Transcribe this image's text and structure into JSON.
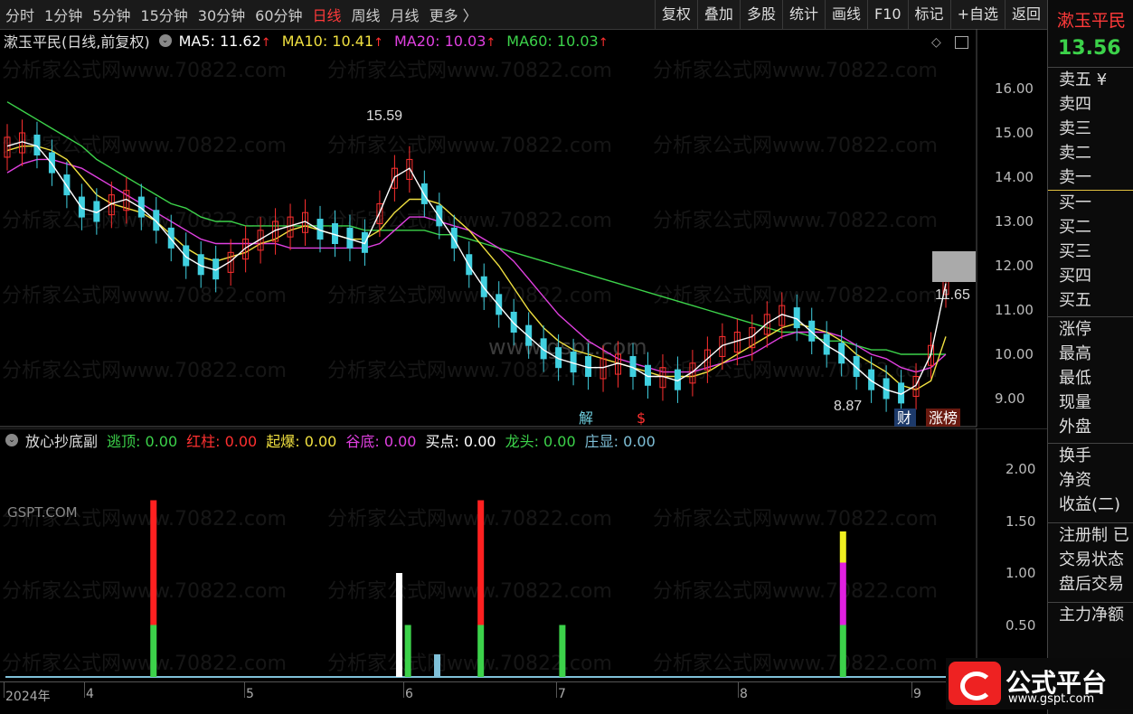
{
  "toolbar": {
    "periods": [
      "分时",
      "1分钟",
      "5分钟",
      "15分钟",
      "30分钟",
      "60分钟",
      "日线",
      "周线",
      "月线",
      "更多 〉"
    ],
    "active_period": "日线",
    "tools": [
      "复权",
      "叠加",
      "多股",
      "统计",
      "画线",
      "F10",
      "标记",
      "+自选",
      "返回"
    ]
  },
  "main_header": {
    "stock_label": "漱玉平民(日线,前复权)",
    "ma": [
      {
        "label": "MA5: 11.62",
        "color": "#ffffff"
      },
      {
        "label": "MA10: 10.41",
        "color": "#f0e040"
      },
      {
        "label": "MA20: 10.03",
        "color": "#e040e0"
      },
      {
        "label": "MA60: 10.03",
        "color": "#3cd24a"
      }
    ],
    "up_arrow": "↑"
  },
  "sub_header": {
    "name": "放心抄底副",
    "indicators": [
      {
        "label": "逃顶: 0.00",
        "color": "#3cd24a"
      },
      {
        "label": "红柱: 0.00",
        "color": "#ff3030"
      },
      {
        "label": "起爆: 0.00",
        "color": "#f0e040"
      },
      {
        "label": "谷底: 0.00",
        "color": "#e040e0"
      },
      {
        "label": "买点: 0.00",
        "color": "#ffffff"
      },
      {
        "label": "龙头: 0.00",
        "color": "#3cd24a"
      },
      {
        "label": "庄显: 0.00",
        "color": "#7fc0d8"
      }
    ]
  },
  "chart_data": [
    {
      "type": "candlestick",
      "y_ticks": [
        "16.00",
        "15.00",
        "14.00",
        "13.00",
        "12.00",
        "11.00",
        "10.00",
        "9.00"
      ],
      "ylim": [
        8.6,
        16.4
      ],
      "annotations": {
        "high": "15.59",
        "low": "8.87",
        "last": "11.65"
      },
      "markers": [
        "解",
        "$",
        "财",
        "涨榜"
      ],
      "ma5": [
        14.7,
        14.8,
        14.7,
        14.3,
        13.8,
        13.3,
        13.2,
        13.4,
        13.5,
        13.3,
        13.0,
        12.6,
        12.2,
        12.0,
        11.9,
        12.1,
        12.4,
        12.6,
        12.8,
        12.9,
        13.0,
        12.8,
        12.7,
        12.6,
        12.5,
        13.2,
        14.0,
        14.2,
        13.6,
        13.1,
        12.6,
        12.0,
        11.5,
        11.1,
        10.7,
        10.4,
        10.1,
        9.9,
        9.8,
        9.7,
        9.7,
        9.8,
        9.7,
        9.5,
        9.5,
        9.4,
        9.6,
        9.9,
        10.2,
        10.3,
        10.4,
        10.7,
        10.9,
        10.8,
        10.5,
        10.2,
        10.0,
        9.7,
        9.4,
        9.2,
        9.1,
        9.3,
        10.0,
        11.6
      ],
      "ma10": [
        14.6,
        14.7,
        14.7,
        14.6,
        14.4,
        14.0,
        13.6,
        13.4,
        13.3,
        13.2,
        13.0,
        12.7,
        12.4,
        12.2,
        12.1,
        12.2,
        12.3,
        12.5,
        12.6,
        12.8,
        12.9,
        12.8,
        12.7,
        12.6,
        12.6,
        12.8,
        13.2,
        13.5,
        13.5,
        13.4,
        13.1,
        12.8,
        12.4,
        12.0,
        11.5,
        11.0,
        10.6,
        10.3,
        10.1,
        10.0,
        9.9,
        9.8,
        9.7,
        9.6,
        9.5,
        9.5,
        9.5,
        9.6,
        9.8,
        10.0,
        10.2,
        10.4,
        10.6,
        10.7,
        10.6,
        10.5,
        10.3,
        10.0,
        9.8,
        9.6,
        9.3,
        9.2,
        9.4,
        10.4
      ],
      "ma20": [
        14.1,
        14.3,
        14.4,
        14.4,
        14.3,
        14.2,
        14.0,
        13.8,
        13.6,
        13.4,
        13.2,
        13.0,
        12.8,
        12.6,
        12.5,
        12.5,
        12.5,
        12.5,
        12.5,
        12.4,
        12.4,
        12.4,
        12.4,
        12.4,
        12.4,
        12.5,
        12.8,
        13.1,
        13.1,
        13.0,
        12.9,
        12.8,
        12.6,
        12.4,
        12.1,
        11.7,
        11.3,
        10.9,
        10.6,
        10.3,
        10.1,
        9.9,
        9.8,
        9.7,
        9.6,
        9.6,
        9.6,
        9.7,
        9.8,
        9.9,
        10.0,
        10.2,
        10.4,
        10.5,
        10.5,
        10.5,
        10.4,
        10.2,
        10.0,
        9.9,
        9.7,
        9.6,
        9.7,
        10.0
      ],
      "ma60": [
        15.7,
        15.5,
        15.3,
        15.1,
        14.9,
        14.7,
        14.4,
        14.2,
        14.0,
        13.8,
        13.6,
        13.4,
        13.3,
        13.1,
        13.0,
        13.0,
        12.9,
        12.9,
        12.9,
        12.9,
        12.9,
        12.9,
        12.9,
        12.9,
        12.8,
        12.8,
        12.8,
        12.8,
        12.8,
        12.7,
        12.7,
        12.6,
        12.5,
        12.4,
        12.3,
        12.2,
        12.1,
        12.0,
        11.9,
        11.8,
        11.7,
        11.6,
        11.5,
        11.4,
        11.3,
        11.2,
        11.1,
        11.0,
        10.9,
        10.8,
        10.7,
        10.6,
        10.5,
        10.5,
        10.4,
        10.3,
        10.3,
        10.2,
        10.1,
        10.1,
        10.0,
        10.0,
        10.0,
        10.0
      ]
    },
    {
      "type": "bar",
      "y_ticks": [
        "2.00",
        "1.50",
        "1.00",
        "0.50"
      ],
      "ylim": [
        0,
        2.25
      ],
      "bars": [
        {
          "x": 0.152,
          "segments": [
            {
              "v": 0.5,
              "color": "#3cd24a"
            },
            {
              "v": 1.2,
              "color": "#ff2020"
            }
          ]
        },
        {
          "x": 0.405,
          "segments": [
            {
              "v": 1.0,
              "color": "#ffffff"
            }
          ]
        },
        {
          "x": 0.414,
          "segments": [
            {
              "v": 0.5,
              "color": "#3cd24a"
            }
          ]
        },
        {
          "x": 0.489,
          "segments": [
            {
              "v": 0.5,
              "color": "#3cd24a"
            },
            {
              "v": 1.2,
              "color": "#ff2020"
            }
          ]
        },
        {
          "x": 0.573,
          "segments": [
            {
              "v": 0.5,
              "color": "#3cd24a"
            }
          ]
        },
        {
          "x": 0.862,
          "segments": [
            {
              "v": 0.5,
              "color": "#3cd24a"
            },
            {
              "v": 0.6,
              "color": "#e020e0"
            },
            {
              "v": 0.3,
              "color": "#f0f020"
            }
          ]
        }
      ],
      "x_labels": [
        "2024年",
        "4",
        "5",
        "6",
        "7",
        "8",
        "9"
      ]
    }
  ],
  "right_panel": {
    "stock_name": "漱玉平民",
    "price": "13.56",
    "rows_sell": [
      "卖五 ¥",
      "卖四",
      "卖三",
      "卖二",
      "卖一"
    ],
    "rows_buy": [
      "买一",
      "买二",
      "买三",
      "买四",
      "买五"
    ],
    "rows_stats": [
      "涨停",
      "最高",
      "最低",
      "现量",
      "外盘"
    ],
    "rows_stats2": [
      "换手",
      "净资",
      "收益(二)"
    ],
    "rows_misc": [
      "注册制 已",
      "交易状态",
      "盘后交易"
    ],
    "rows_bottom": [
      "主力净额"
    ]
  },
  "watermark": "分析家公式网www.70822.com",
  "watermark2": "www.gspt.com",
  "watermark3": "GSPT.COM",
  "logo": {
    "text": "公式平台",
    "url": "www.gspt.com"
  }
}
